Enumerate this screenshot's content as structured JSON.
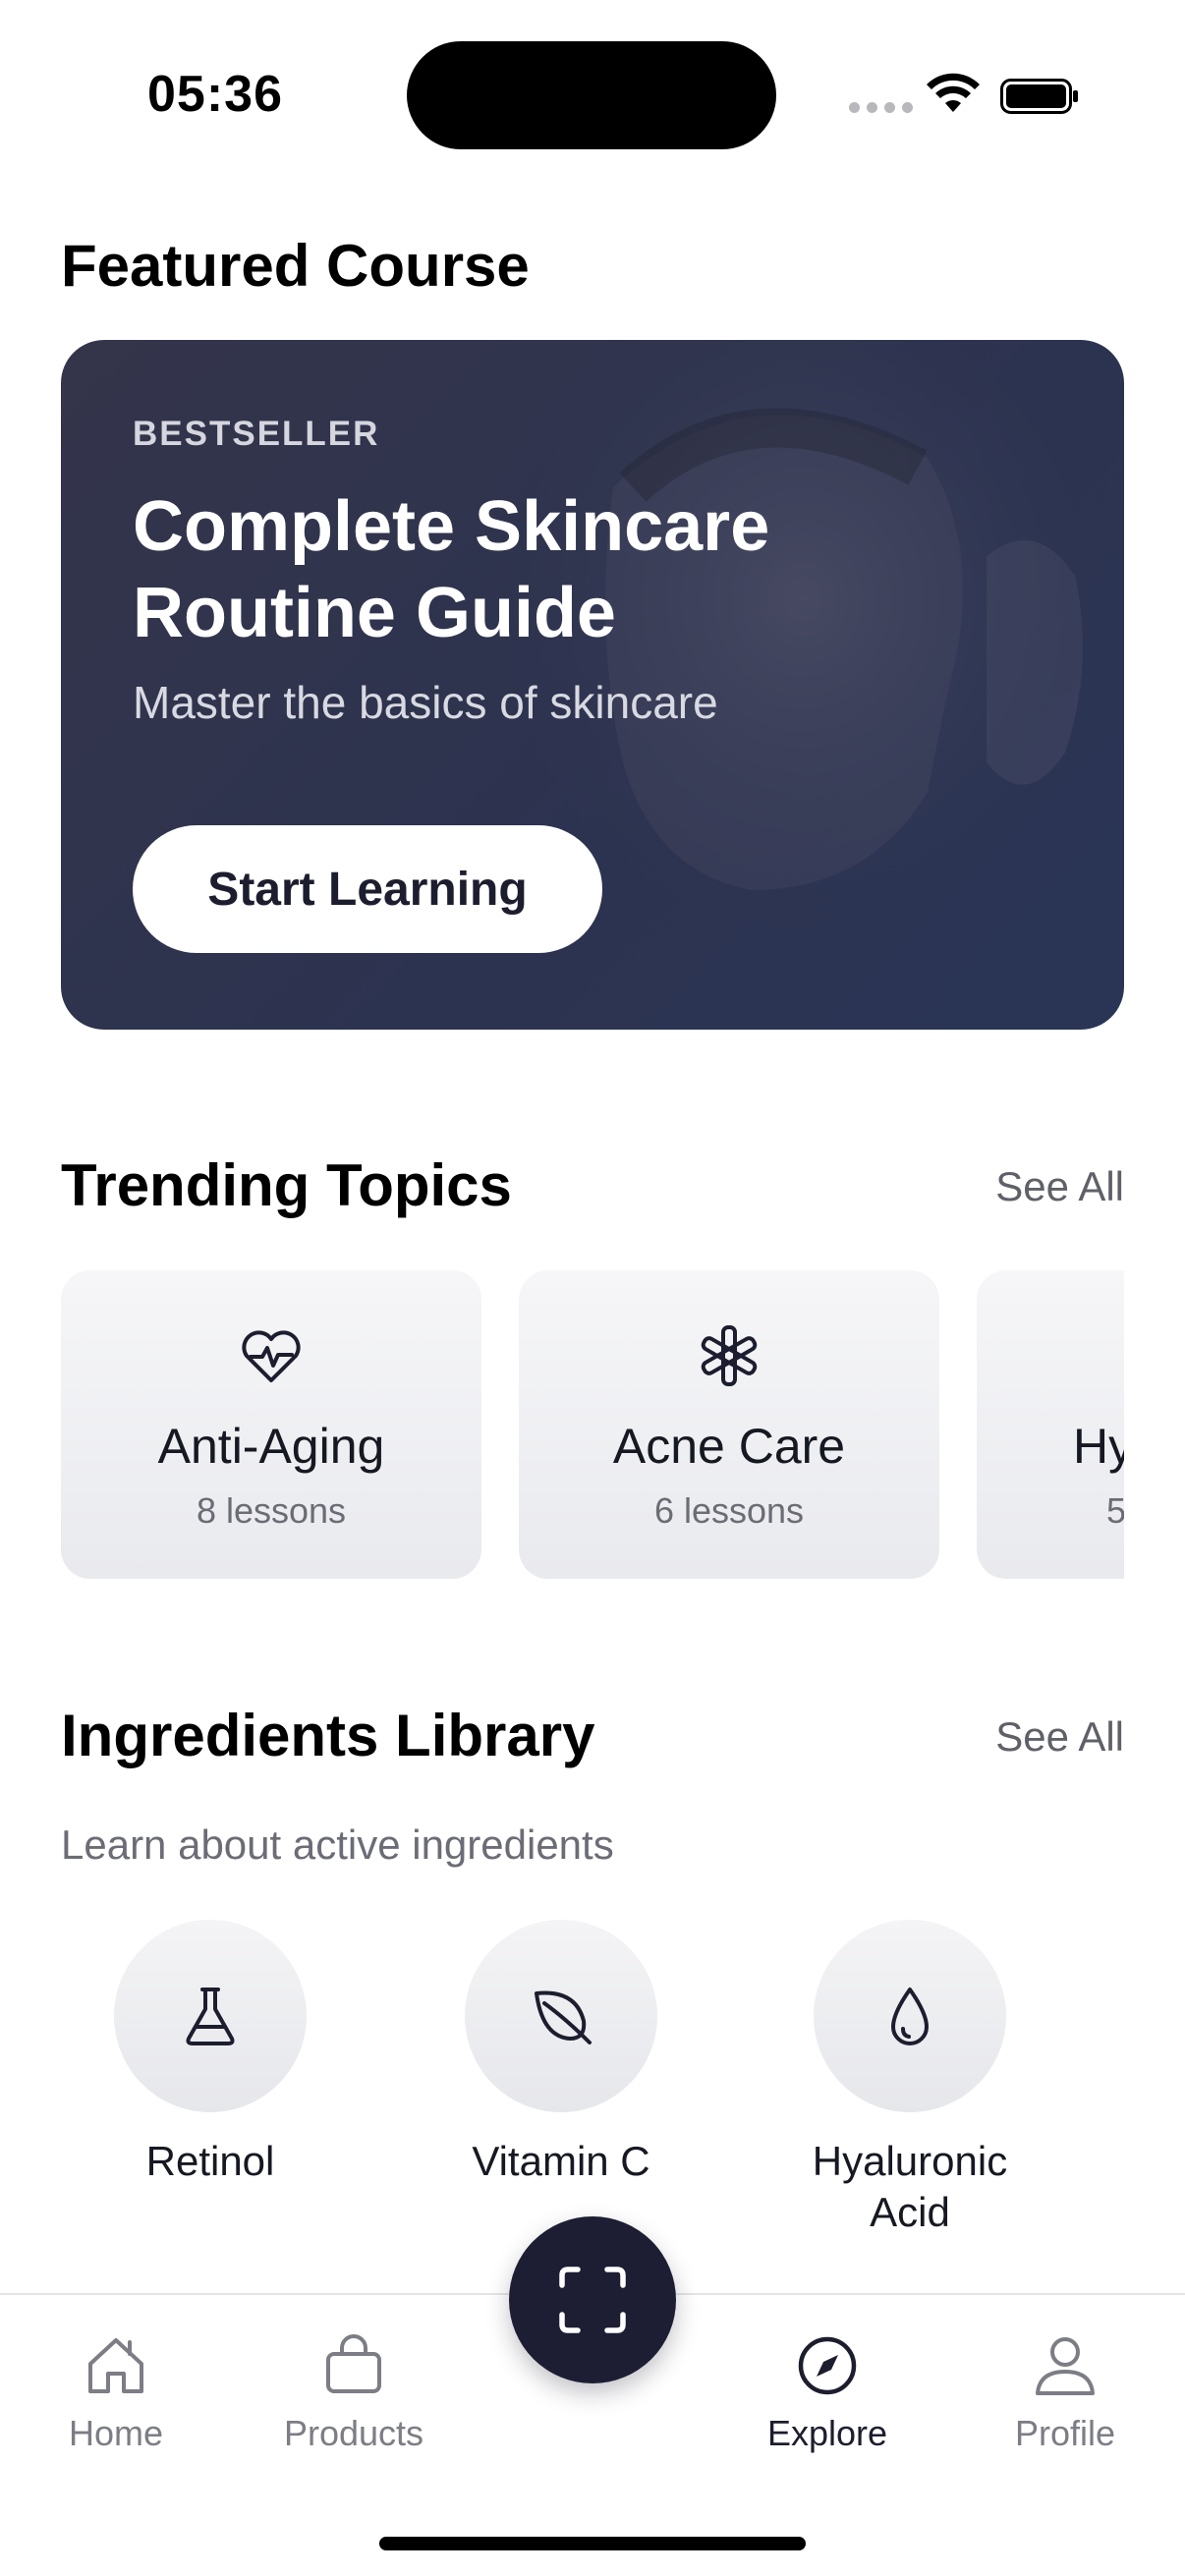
{
  "status_bar": {
    "time": "05:36"
  },
  "featured": {
    "heading": "Featured Course",
    "badge": "BESTSELLER",
    "title": "Complete Skincare Routine Guide",
    "subtitle": "Master the basics of skincare",
    "button_label": "Start Learning"
  },
  "trending": {
    "heading": "Trending Topics",
    "see_all": "See All",
    "topics": [
      {
        "name": "Anti-Aging",
        "count": "8 lessons",
        "icon": "heart-pulse-icon"
      },
      {
        "name": "Acne Care",
        "count": "6 lessons",
        "icon": "asterisk-icon"
      },
      {
        "name": "Hy",
        "count": "5",
        "icon": ""
      }
    ]
  },
  "ingredients": {
    "heading": "Ingredients Library",
    "see_all": "See All",
    "subtitle": "Learn about active ingredients",
    "items": [
      {
        "name": "Retinol",
        "icon": "flask-icon"
      },
      {
        "name": "Vitamin C",
        "icon": "leaf-icon"
      },
      {
        "name": "Hyaluronic Acid",
        "icon": "droplet-icon"
      }
    ]
  },
  "tab_bar": {
    "tabs": [
      {
        "label": "Home",
        "icon": "home-icon",
        "active": false
      },
      {
        "label": "Products",
        "icon": "bag-icon",
        "active": false
      },
      {
        "label": "Explore",
        "icon": "compass-icon",
        "active": true
      },
      {
        "label": "Profile",
        "icon": "person-icon",
        "active": false
      }
    ],
    "center_action_icon": "scan-icon"
  },
  "colors": {
    "accent_dark": "#1d1d34",
    "card_bg": "#2c3350",
    "muted_text": "#6b6c75"
  }
}
